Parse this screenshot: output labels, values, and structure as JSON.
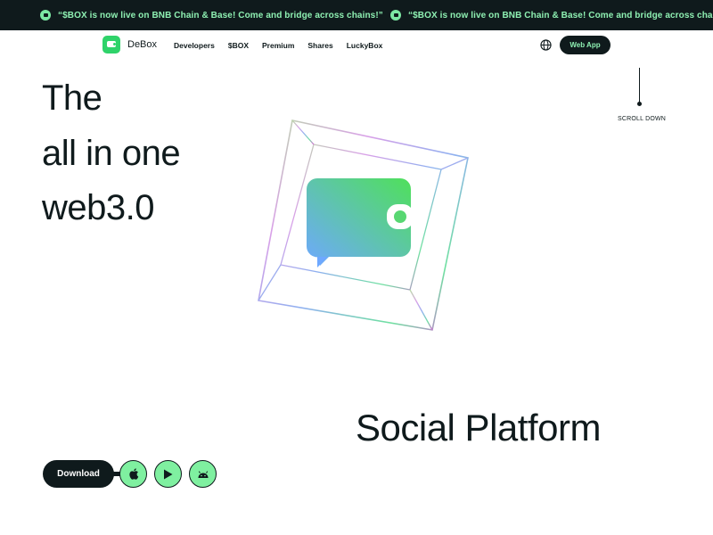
{
  "ticker": {
    "items": [
      "“$BOX is now live on BNB Chain & Base! Come and bridge across chains!”",
      "“$BOX is now live on BNB Chain & Base! Come and bridge across chains!”"
    ]
  },
  "nav": {
    "brand": "DeBox",
    "links": [
      "Developers",
      "$BOX",
      "Premium",
      "Shares",
      "LuckyBox"
    ],
    "cta": "Web App",
    "language_icon": "globe-icon"
  },
  "hero": {
    "line1": "The",
    "line2": "all in one",
    "line3": "web3.0",
    "tagline": "Social Platform"
  },
  "scroll": {
    "label": "SCROLL DOWN"
  },
  "download": {
    "label": "Download",
    "stores": [
      "apple-icon",
      "play-icon",
      "android-icon"
    ]
  },
  "colors": {
    "dark": "#0f1a1c",
    "accent_green": "#2fd36a",
    "ticker_text": "#8ef0b2",
    "store_button": "#7ff0a0",
    "gradient_start": "#6ea8ff",
    "gradient_end": "#4fe05a"
  }
}
